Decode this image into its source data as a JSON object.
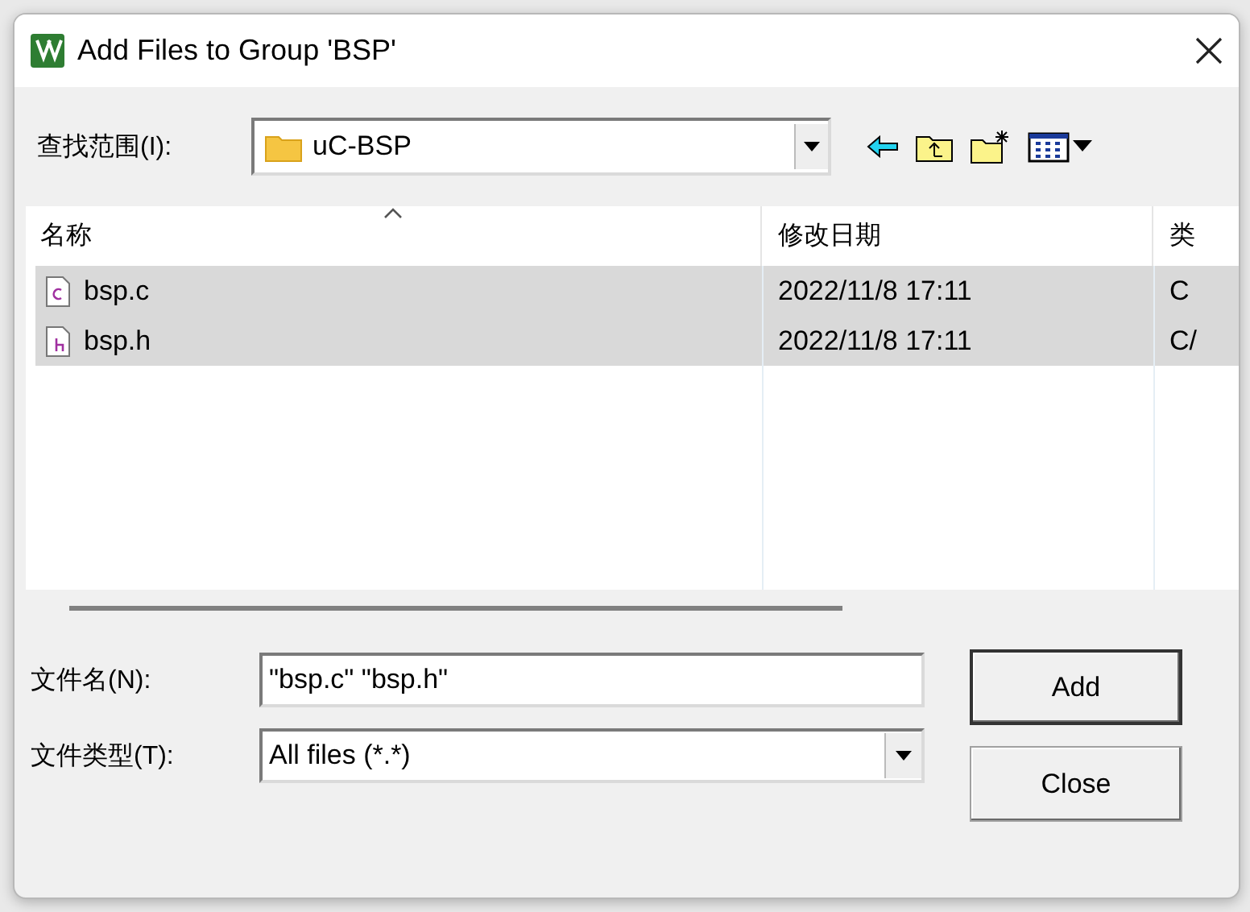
{
  "window": {
    "title": "Add Files to Group 'BSP'"
  },
  "look_in": {
    "label": "查找范围(I):",
    "value": "uC-BSP"
  },
  "file_list": {
    "columns": [
      "名称",
      "修改日期",
      "类"
    ],
    "rows": [
      {
        "name": "bsp.c",
        "modified": "2022/11/8 17:11",
        "column_3": "C",
        "kind": "source",
        "selected": true
      },
      {
        "name": "bsp.h",
        "modified": "2022/11/8 17:11",
        "column_3": "C/",
        "kind": "header",
        "selected": true
      }
    ]
  },
  "file_name": {
    "label": "文件名(N):",
    "value": "\"bsp.c\" \"bsp.h\""
  },
  "file_type": {
    "label": "文件类型(T):",
    "value": "All files (*.*)"
  },
  "buttons": [
    {
      "label": "Add",
      "default": true
    },
    {
      "label": "Close",
      "default": false
    }
  ]
}
